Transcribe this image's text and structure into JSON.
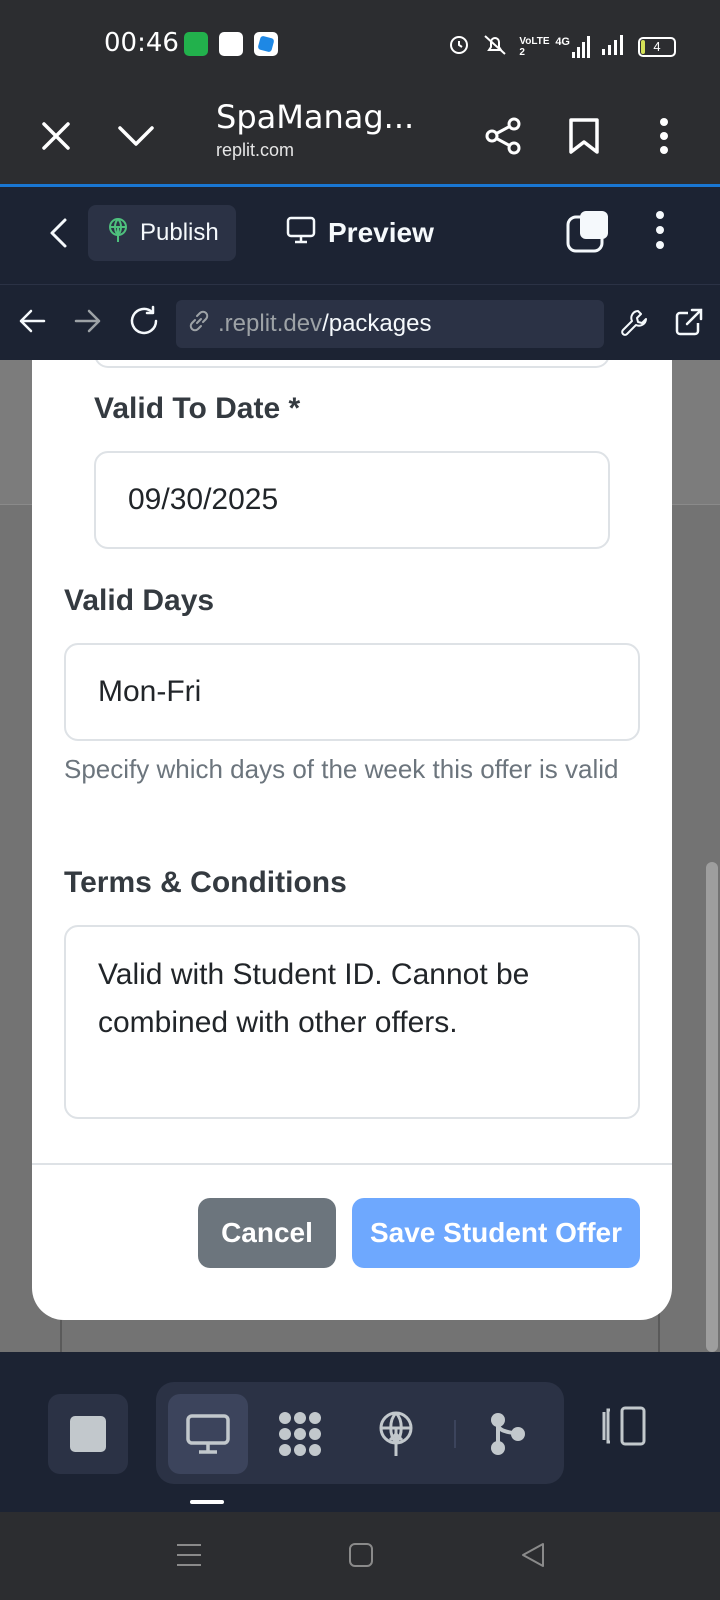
{
  "status_bar": {
    "time": "00:46",
    "network_label": "4G",
    "volte_label": "VoLTE 2",
    "battery_level": "4"
  },
  "browser": {
    "tab_title": "SpaManag...",
    "domain": "replit.com"
  },
  "replit_toolbar": {
    "publish_label": "Publish",
    "preview_label": "Preview"
  },
  "url_bar": {
    "url_prefix": ".replit.dev",
    "url_path": "/packages"
  },
  "form": {
    "valid_to_label": "Valid To Date *",
    "valid_to_value": "09/30/2025",
    "valid_days_label": "Valid Days",
    "valid_days_value": "Mon-Fri",
    "valid_days_help": "Specify which days of the week this offer is valid",
    "terms_label": "Terms & Conditions",
    "terms_value": "Valid with Student ID. Cannot be combined with other offers.",
    "cancel_label": "Cancel",
    "save_label": "Save Student Offer"
  },
  "colors": {
    "save_button": "#6ea8fe",
    "cancel_button": "#6c757d",
    "replit_bg": "#1c2333",
    "load_bar": "#1976d2"
  }
}
